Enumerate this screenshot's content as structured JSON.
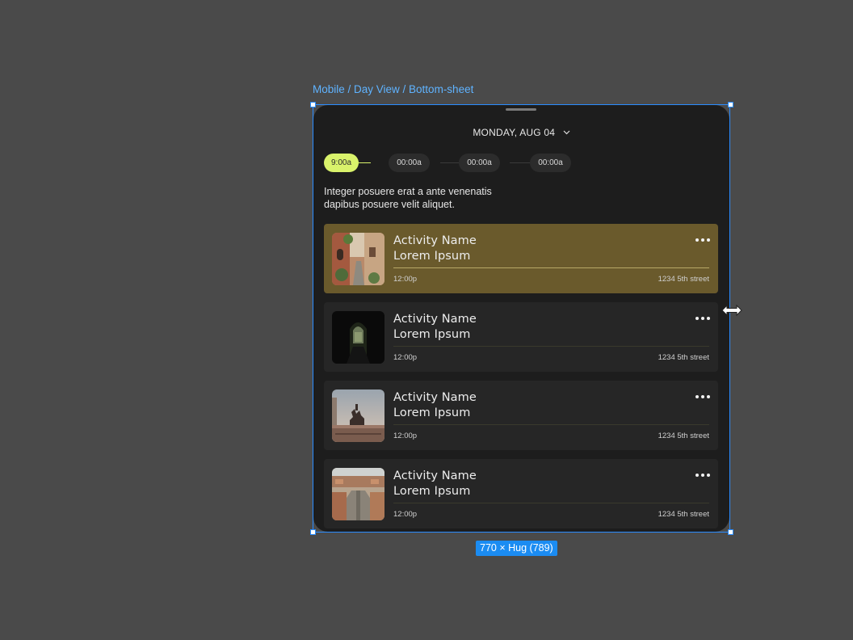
{
  "frame": {
    "label": "Mobile / Day View / Bottom-sheet",
    "size_badge": "770 × Hug (789)"
  },
  "header": {
    "date_label": "MONDAY, AUG 04",
    "chevron_icon": "chevron-down-icon"
  },
  "timeline": {
    "items": [
      {
        "label": "9:00a",
        "active": true
      },
      {
        "label": "00:00a",
        "active": false
      },
      {
        "label": "00:00a",
        "active": false
      },
      {
        "label": "00:00a",
        "active": false
      }
    ]
  },
  "description": {
    "line1": "Integer posuere erat a ante venenatis",
    "line2": "dapibus posuere velit aliquet."
  },
  "activities": [
    {
      "title": "Activity Name",
      "subtitle": "Lorem Ipsum",
      "time": "12:00p",
      "address": "1234 5th street",
      "highlighted": true
    },
    {
      "title": "Activity Name",
      "subtitle": "Lorem Ipsum",
      "time": "12:00p",
      "address": "1234 5th street",
      "highlighted": false
    },
    {
      "title": "Activity Name",
      "subtitle": "Lorem Ipsum",
      "time": "12:00p",
      "address": "1234 5th street",
      "highlighted": false
    },
    {
      "title": "Activity Name",
      "subtitle": "Lorem Ipsum",
      "time": "12:00p",
      "address": "1234 5th street",
      "highlighted": false
    }
  ],
  "colors": {
    "canvas": "#4a4a4a",
    "sheet": "#1d1d1d",
    "card": "#262626",
    "card_highlight": "#6a5a2c",
    "accent": "#d9f26b",
    "selection": "#2a8cff"
  }
}
